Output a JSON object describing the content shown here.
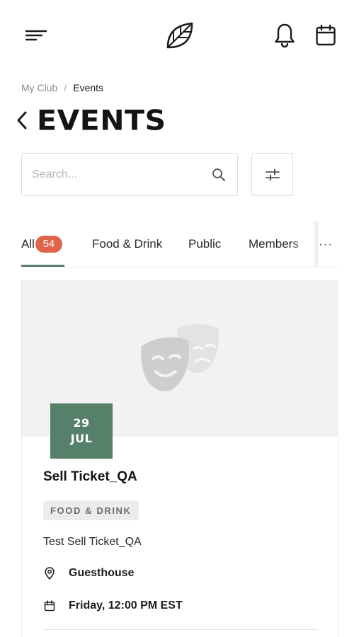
{
  "header": {
    "menu_icon": "hamburger-menu-icon",
    "logo_icon": "leaf-logo-icon",
    "notification_icon": "bell-icon",
    "calendar_icon": "calendar-icon"
  },
  "breadcrumb": {
    "parent": "My Club",
    "separator": "/",
    "current": "Events"
  },
  "page": {
    "back_icon": "chevron-left-icon",
    "title": "EVENTS"
  },
  "search": {
    "placeholder": "Search...",
    "value": "",
    "icon": "search-icon"
  },
  "filter": {
    "icon": "sliders-icon"
  },
  "tabs": [
    {
      "label": "All",
      "count": "54",
      "active": true
    },
    {
      "label": "Food & Drink"
    },
    {
      "label": "Public"
    },
    {
      "label": "Members"
    }
  ],
  "tabs_more": "···",
  "event": {
    "image_icon": "theater-masks-icon",
    "date_day": "29",
    "date_month": "JUL",
    "title": "Sell Ticket_QA",
    "category": "FOOD & DRINK",
    "description": "Test Sell Ticket_QA",
    "location_icon": "map-pin-icon",
    "location": "Guesthouse",
    "time_icon": "calendar-icon",
    "time": "Friday, 12:00 PM EST"
  },
  "colors": {
    "accent": "#56806a",
    "badge": "#e0644a",
    "card_image_bg": "#f2f2f2",
    "tag_bg": "#ececec"
  }
}
